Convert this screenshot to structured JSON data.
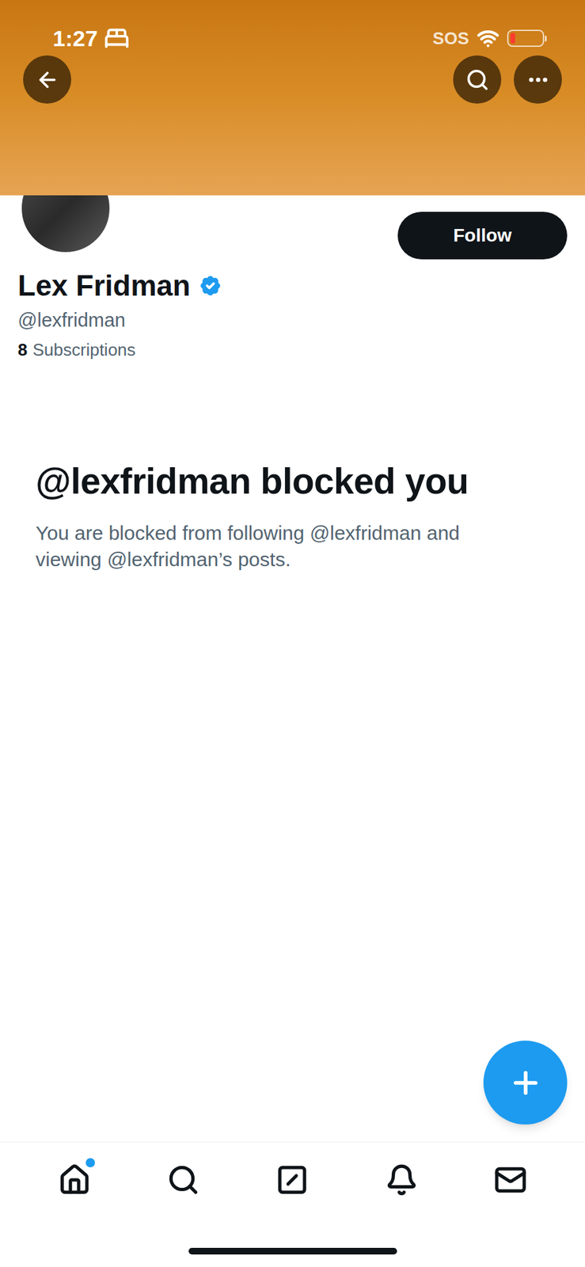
{
  "status_bar": {
    "time": "1:27",
    "sos": "SOS",
    "battery": {
      "level": 0.15,
      "low": true
    }
  },
  "profile": {
    "name": "Lex Fridman",
    "verified": true,
    "handle": "@lexfridman",
    "subscriptions_count": "8",
    "subscriptions_label": "Subscriptions"
  },
  "follow_button": "Follow",
  "blocked": {
    "title": "@lexfridman blocked you",
    "message": "You are blocked from following @lexfridman and viewing @lexfridman’s posts."
  },
  "nav": [
    {
      "icon": "home",
      "unread": true
    },
    {
      "icon": "search",
      "unread": false
    },
    {
      "icon": "grok",
      "unread": false
    },
    {
      "icon": "notifications",
      "unread": false
    },
    {
      "icon": "messages",
      "unread": false
    }
  ]
}
